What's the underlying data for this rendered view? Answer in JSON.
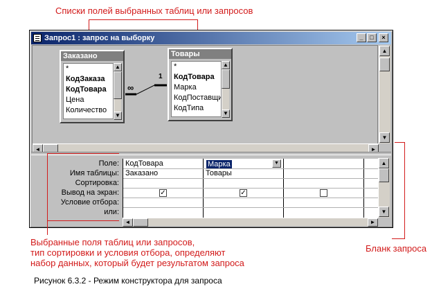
{
  "annotations": {
    "top": "Списки полей выбранных таблиц или запросов",
    "bottom_left": [
      "Выбранные поля таблиц или запросов,",
      "тип сортировки и условия отбора, определяют",
      "набор данных, который будет результатом запроса"
    ],
    "right": "Бланк запроса"
  },
  "caption": "Рисунок 6.3.2 - Режим конструктора для запроса",
  "window": {
    "title": "Запрос1 : запрос на выборку",
    "buttons": {
      "minimize": "_",
      "maximize": "□",
      "close": "×"
    }
  },
  "tables": [
    {
      "name": "Заказано",
      "fields": [
        {
          "label": "*",
          "bold": false
        },
        {
          "label": "КодЗаказа",
          "bold": true
        },
        {
          "label": "КодТовара",
          "bold": true
        },
        {
          "label": "Цена",
          "bold": false
        },
        {
          "label": "Количество",
          "bold": false
        }
      ]
    },
    {
      "name": "Товары",
      "fields": [
        {
          "label": "*",
          "bold": false
        },
        {
          "label": "КодТовара",
          "bold": true
        },
        {
          "label": "Марка",
          "bold": false
        },
        {
          "label": "КодПоставщи",
          "bold": false
        },
        {
          "label": "КодТипа",
          "bold": false
        }
      ]
    }
  ],
  "relationship": {
    "one_side": "1",
    "many_side": "∞"
  },
  "grid": {
    "row_labels": [
      "Поле:",
      "Имя таблицы:",
      "Сортировка:",
      "Вывод на экран:",
      "Условие отбора:",
      "или:"
    ],
    "columns": [
      {
        "field": "КодТовара",
        "table": "Заказано",
        "sort": "",
        "show": true,
        "criteria": "",
        "or": ""
      },
      {
        "field": "Марка",
        "table": "Товары",
        "sort": "",
        "show": true,
        "criteria": "",
        "or": ""
      },
      {
        "field": "",
        "table": "",
        "sort": "",
        "show": false,
        "criteria": "",
        "or": ""
      }
    ]
  },
  "colors": {
    "annotation": "#d21a1a",
    "title_bar": "#0a246a",
    "window_face": "#c0c0c0"
  }
}
